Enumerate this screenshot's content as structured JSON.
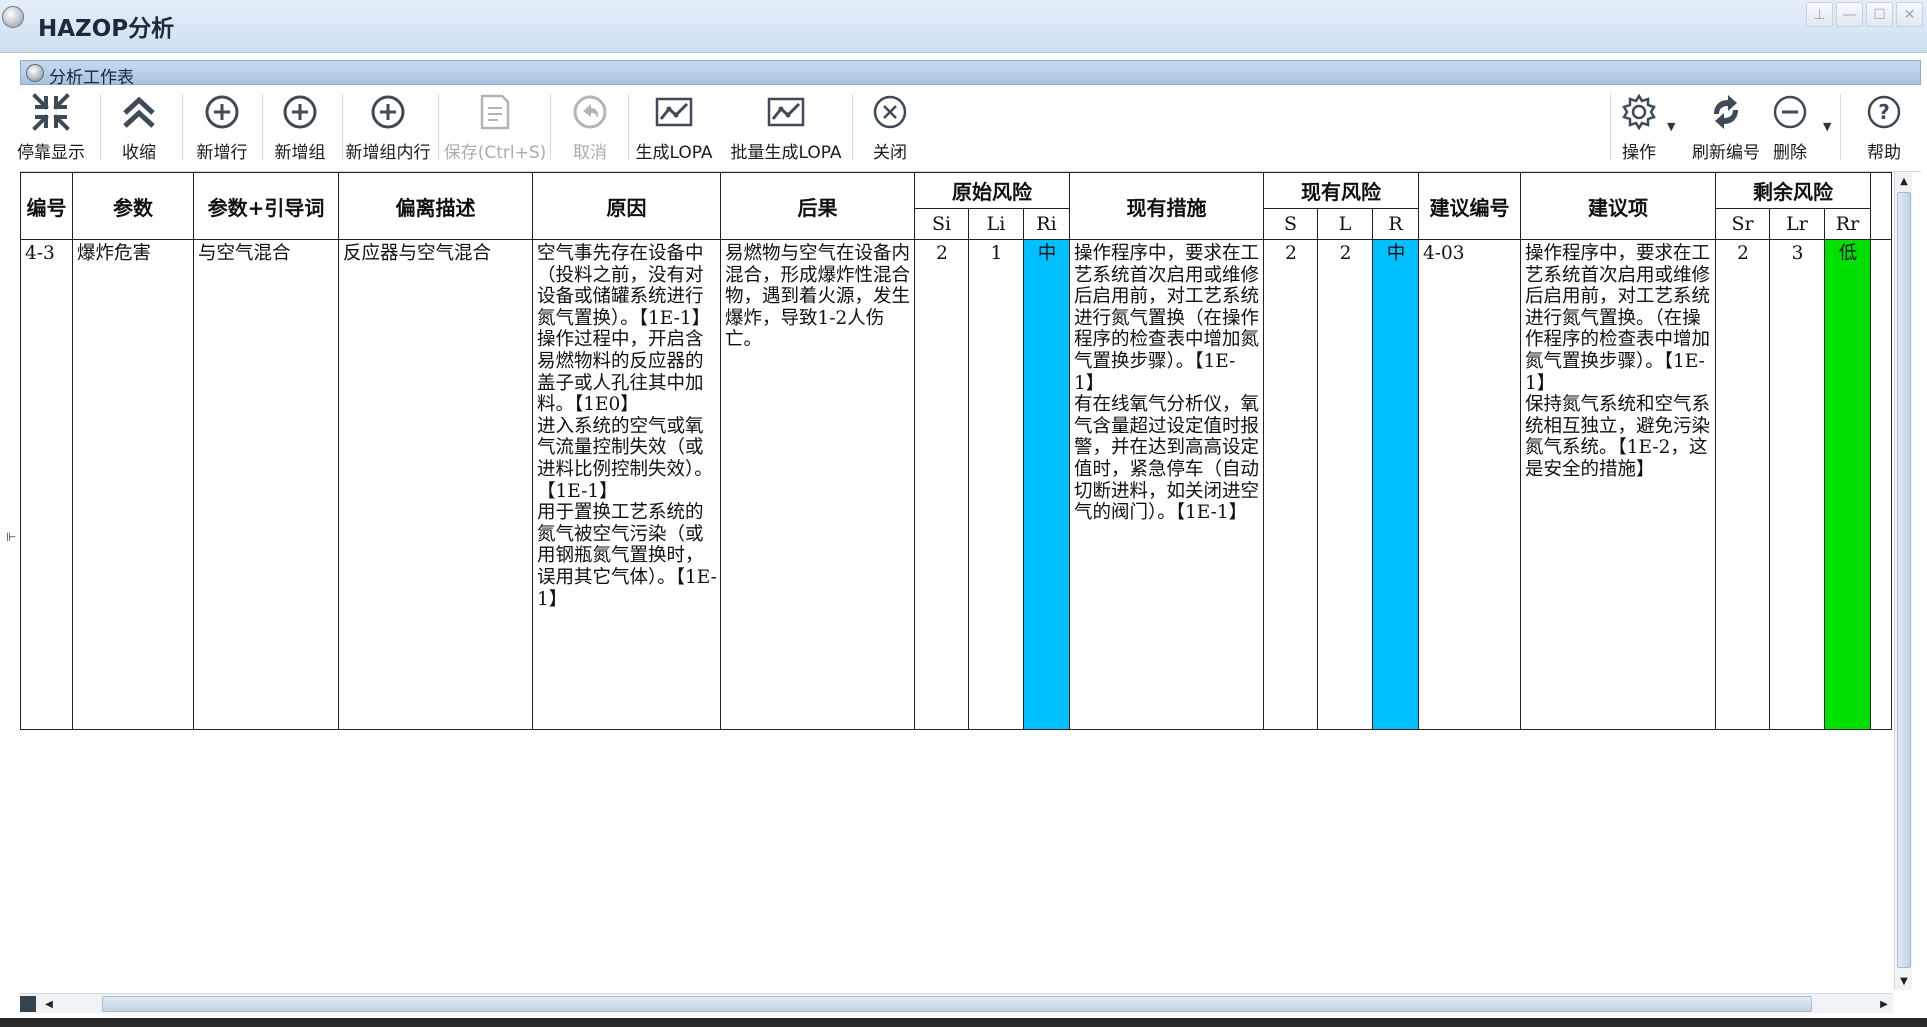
{
  "window": {
    "title": "HAZOP分析",
    "buttons": {
      "pin": "⊥",
      "minimize": "—",
      "maximize": "☐",
      "close": "✕"
    }
  },
  "panel": {
    "title": "分析工作表"
  },
  "toolbar": {
    "dock": "停靠显示",
    "collapse": "收缩",
    "add_row": "新增行",
    "add_group": "新增组",
    "add_group_row": "新增组内行",
    "save": "保存(Ctrl+S)",
    "cancel": "取消",
    "gen_lopa": "生成LOPA",
    "batch_lopa": "批量生成LOPA",
    "close": "关闭",
    "operate": "操作",
    "refresh_no": "刷新编号",
    "delete": "删除",
    "help": "帮助"
  },
  "table": {
    "headers": {
      "no": "编号",
      "param": "参数",
      "param_guide": "参数+引导词",
      "deviation": "偏离描述",
      "cause": "原因",
      "consequence": "后果",
      "orig_risk": "原始风险",
      "existing_measures": "现有措施",
      "current_risk": "现有风险",
      "suggest_no": "建议编号",
      "suggestion": "建议项",
      "residual_risk": "剩余风险"
    },
    "subheaders": {
      "si": "Si",
      "li": "Li",
      "ri": "Ri",
      "s": "S",
      "l": "L",
      "r": "R",
      "sr": "Sr",
      "lr": "Lr",
      "rr": "Rr"
    },
    "row": {
      "no": "4-3",
      "param": "爆炸危害",
      "param_guide": "与空气混合",
      "deviation": "反应器与空气混合",
      "cause": "空气事先存在设备中（投料之前，没有对设备或储罐系统进行氮气置换）。【1E-1】\n操作过程中，开启含易燃物料的反应器的盖子或人孔往其中加料。【1E0】\n进入系统的空气或氧气流量控制失效（或进料比例控制失效）。【1E-1】\n用于置换工艺系统的氮气被空气污染（或用钢瓶氮气置换时，误用其它气体）。【1E-1】",
      "consequence": "易燃物与空气在设备内混合，形成爆炸性混合物，遇到着火源，发生爆炸，导致1-2人伤亡。",
      "si": "2",
      "li": "1",
      "ri": "中",
      "existing_measures": "操作程序中，要求在工艺系统首次启用或维修后启用前，对工艺系统进行氮气置换（在操作程序的检查表中增加氮气置换步骤）。【1E-1】\n有在线氧气分析仪，氧气含量超过设定值时报警，并在达到高高设定值时，紧急停车（自动切断进料，如关闭进空气的阀门）。【1E-1】",
      "s": "2",
      "l": "2",
      "r": "中",
      "suggest_no": "4-03",
      "suggestion": "操作程序中，要求在工艺系统首次启用或维修后启用前，对工艺系统进行氮气置换。（在操作程序的检查表中增加氮气置换步骤）。【1E-1】\n保持氮气系统和空气系统相互独立，避免污染氮气系统。【1E-2，这是安全的措施】",
      "sr": "2",
      "lr": "3",
      "rr": "低"
    }
  },
  "colors": {
    "risk_medium": "#00c0ff",
    "risk_low": "#00e000"
  }
}
